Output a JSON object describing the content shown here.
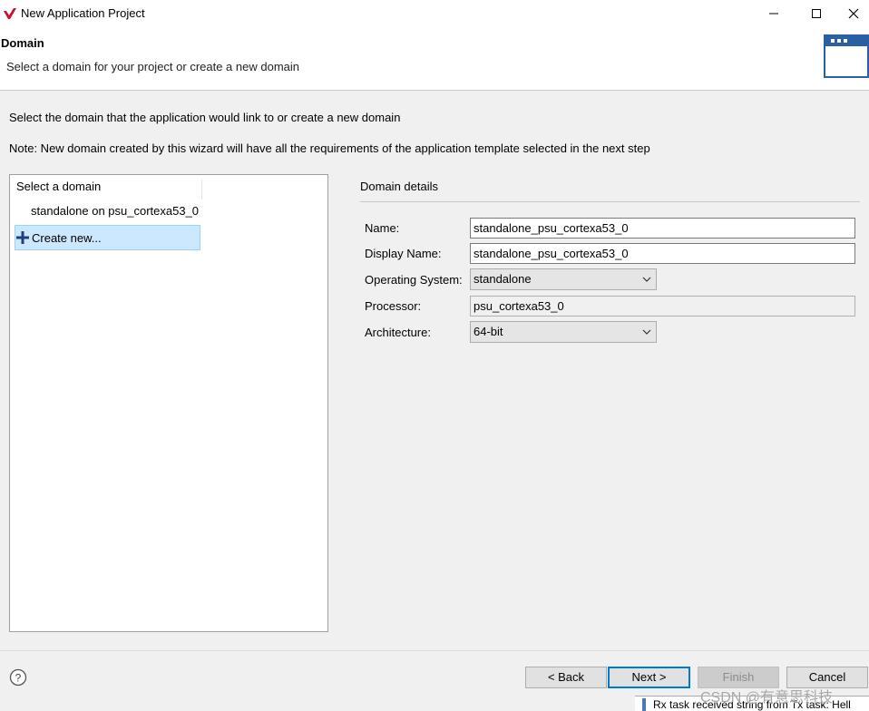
{
  "window": {
    "title": "New Application Project",
    "minimize_icon": "minimize-icon",
    "maximize_icon": "maximize-icon",
    "close_icon": "close-icon"
  },
  "header": {
    "title": "Domain",
    "subtitle": "Select a domain for your project or create a new domain"
  },
  "instructions": {
    "intro": "Select the domain that the application would link to or create a new domain",
    "note": "Note: New domain created by this wizard will have all the requirements of the application template selected in the next step"
  },
  "domain_list": {
    "header": "Select a domain",
    "items": [
      {
        "label": "standalone on psu_cortexa53_0"
      },
      {
        "label": "Create new...",
        "icon": "plus-icon",
        "selected": true
      }
    ]
  },
  "details": {
    "title": "Domain details",
    "name_label": "Name:",
    "name_value": "standalone_psu_cortexa53_0",
    "display_name_label": "Display Name:",
    "display_name_value": "standalone_psu_cortexa53_0",
    "os_label": "Operating System:",
    "os_value": "standalone",
    "processor_label": "Processor:",
    "processor_value": "psu_cortexa53_0",
    "arch_label": "Architecture:",
    "arch_value": "64-bit"
  },
  "buttons": {
    "back": "< Back",
    "next": "Next >",
    "finish": "Finish",
    "cancel": "Cancel",
    "help_icon": "help-icon"
  },
  "console": {
    "text": "Rx task received string from Tx task: Hell"
  },
  "watermark": "CSDN @有意思科技",
  "colors": {
    "selection": "#cce8ff",
    "primary_border": "#0078d7",
    "logo": "#c8102e"
  }
}
